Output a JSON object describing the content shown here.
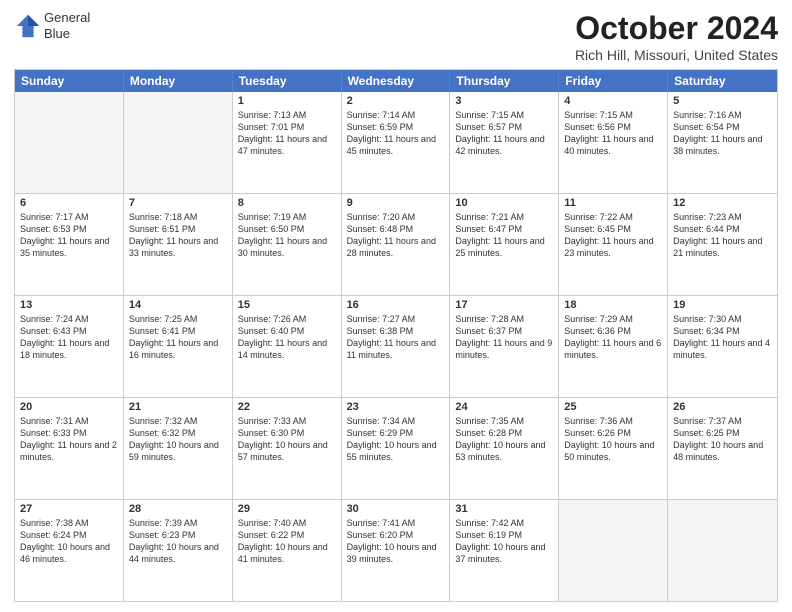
{
  "logo": {
    "line1": "General",
    "line2": "Blue"
  },
  "title": "October 2024",
  "subtitle": "Rich Hill, Missouri, United States",
  "header_days": [
    "Sunday",
    "Monday",
    "Tuesday",
    "Wednesday",
    "Thursday",
    "Friday",
    "Saturday"
  ],
  "weeks": [
    [
      {
        "day": "",
        "sunrise": "",
        "sunset": "",
        "daylight": "",
        "empty": true
      },
      {
        "day": "",
        "sunrise": "",
        "sunset": "",
        "daylight": "",
        "empty": true
      },
      {
        "day": "1",
        "sunrise": "Sunrise: 7:13 AM",
        "sunset": "Sunset: 7:01 PM",
        "daylight": "Daylight: 11 hours and 47 minutes."
      },
      {
        "day": "2",
        "sunrise": "Sunrise: 7:14 AM",
        "sunset": "Sunset: 6:59 PM",
        "daylight": "Daylight: 11 hours and 45 minutes."
      },
      {
        "day": "3",
        "sunrise": "Sunrise: 7:15 AM",
        "sunset": "Sunset: 6:57 PM",
        "daylight": "Daylight: 11 hours and 42 minutes."
      },
      {
        "day": "4",
        "sunrise": "Sunrise: 7:15 AM",
        "sunset": "Sunset: 6:56 PM",
        "daylight": "Daylight: 11 hours and 40 minutes."
      },
      {
        "day": "5",
        "sunrise": "Sunrise: 7:16 AM",
        "sunset": "Sunset: 6:54 PM",
        "daylight": "Daylight: 11 hours and 38 minutes."
      }
    ],
    [
      {
        "day": "6",
        "sunrise": "Sunrise: 7:17 AM",
        "sunset": "Sunset: 6:53 PM",
        "daylight": "Daylight: 11 hours and 35 minutes."
      },
      {
        "day": "7",
        "sunrise": "Sunrise: 7:18 AM",
        "sunset": "Sunset: 6:51 PM",
        "daylight": "Daylight: 11 hours and 33 minutes."
      },
      {
        "day": "8",
        "sunrise": "Sunrise: 7:19 AM",
        "sunset": "Sunset: 6:50 PM",
        "daylight": "Daylight: 11 hours and 30 minutes."
      },
      {
        "day": "9",
        "sunrise": "Sunrise: 7:20 AM",
        "sunset": "Sunset: 6:48 PM",
        "daylight": "Daylight: 11 hours and 28 minutes."
      },
      {
        "day": "10",
        "sunrise": "Sunrise: 7:21 AM",
        "sunset": "Sunset: 6:47 PM",
        "daylight": "Daylight: 11 hours and 25 minutes."
      },
      {
        "day": "11",
        "sunrise": "Sunrise: 7:22 AM",
        "sunset": "Sunset: 6:45 PM",
        "daylight": "Daylight: 11 hours and 23 minutes."
      },
      {
        "day": "12",
        "sunrise": "Sunrise: 7:23 AM",
        "sunset": "Sunset: 6:44 PM",
        "daylight": "Daylight: 11 hours and 21 minutes."
      }
    ],
    [
      {
        "day": "13",
        "sunrise": "Sunrise: 7:24 AM",
        "sunset": "Sunset: 6:43 PM",
        "daylight": "Daylight: 11 hours and 18 minutes."
      },
      {
        "day": "14",
        "sunrise": "Sunrise: 7:25 AM",
        "sunset": "Sunset: 6:41 PM",
        "daylight": "Daylight: 11 hours and 16 minutes."
      },
      {
        "day": "15",
        "sunrise": "Sunrise: 7:26 AM",
        "sunset": "Sunset: 6:40 PM",
        "daylight": "Daylight: 11 hours and 14 minutes."
      },
      {
        "day": "16",
        "sunrise": "Sunrise: 7:27 AM",
        "sunset": "Sunset: 6:38 PM",
        "daylight": "Daylight: 11 hours and 11 minutes."
      },
      {
        "day": "17",
        "sunrise": "Sunrise: 7:28 AM",
        "sunset": "Sunset: 6:37 PM",
        "daylight": "Daylight: 11 hours and 9 minutes."
      },
      {
        "day": "18",
        "sunrise": "Sunrise: 7:29 AM",
        "sunset": "Sunset: 6:36 PM",
        "daylight": "Daylight: 11 hours and 6 minutes."
      },
      {
        "day": "19",
        "sunrise": "Sunrise: 7:30 AM",
        "sunset": "Sunset: 6:34 PM",
        "daylight": "Daylight: 11 hours and 4 minutes."
      }
    ],
    [
      {
        "day": "20",
        "sunrise": "Sunrise: 7:31 AM",
        "sunset": "Sunset: 6:33 PM",
        "daylight": "Daylight: 11 hours and 2 minutes."
      },
      {
        "day": "21",
        "sunrise": "Sunrise: 7:32 AM",
        "sunset": "Sunset: 6:32 PM",
        "daylight": "Daylight: 10 hours and 59 minutes."
      },
      {
        "day": "22",
        "sunrise": "Sunrise: 7:33 AM",
        "sunset": "Sunset: 6:30 PM",
        "daylight": "Daylight: 10 hours and 57 minutes."
      },
      {
        "day": "23",
        "sunrise": "Sunrise: 7:34 AM",
        "sunset": "Sunset: 6:29 PM",
        "daylight": "Daylight: 10 hours and 55 minutes."
      },
      {
        "day": "24",
        "sunrise": "Sunrise: 7:35 AM",
        "sunset": "Sunset: 6:28 PM",
        "daylight": "Daylight: 10 hours and 53 minutes."
      },
      {
        "day": "25",
        "sunrise": "Sunrise: 7:36 AM",
        "sunset": "Sunset: 6:26 PM",
        "daylight": "Daylight: 10 hours and 50 minutes."
      },
      {
        "day": "26",
        "sunrise": "Sunrise: 7:37 AM",
        "sunset": "Sunset: 6:25 PM",
        "daylight": "Daylight: 10 hours and 48 minutes."
      }
    ],
    [
      {
        "day": "27",
        "sunrise": "Sunrise: 7:38 AM",
        "sunset": "Sunset: 6:24 PM",
        "daylight": "Daylight: 10 hours and 46 minutes."
      },
      {
        "day": "28",
        "sunrise": "Sunrise: 7:39 AM",
        "sunset": "Sunset: 6:23 PM",
        "daylight": "Daylight: 10 hours and 44 minutes."
      },
      {
        "day": "29",
        "sunrise": "Sunrise: 7:40 AM",
        "sunset": "Sunset: 6:22 PM",
        "daylight": "Daylight: 10 hours and 41 minutes."
      },
      {
        "day": "30",
        "sunrise": "Sunrise: 7:41 AM",
        "sunset": "Sunset: 6:20 PM",
        "daylight": "Daylight: 10 hours and 39 minutes."
      },
      {
        "day": "31",
        "sunrise": "Sunrise: 7:42 AM",
        "sunset": "Sunset: 6:19 PM",
        "daylight": "Daylight: 10 hours and 37 minutes."
      },
      {
        "day": "",
        "sunrise": "",
        "sunset": "",
        "daylight": "",
        "empty": true
      },
      {
        "day": "",
        "sunrise": "",
        "sunset": "",
        "daylight": "",
        "empty": true
      }
    ]
  ]
}
